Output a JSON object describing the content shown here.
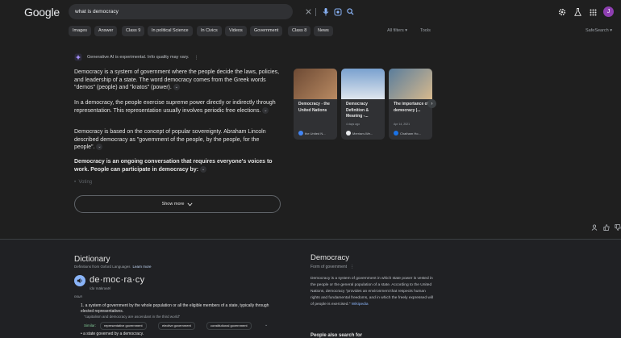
{
  "header": {
    "logo": "Google",
    "search": {
      "value": "what is democracy"
    },
    "avatar_initial": "J"
  },
  "chips": [
    "Images",
    "Answer",
    "Class 9",
    "In political Science",
    "In Civics",
    "Videos",
    "Government",
    "Class 8",
    "News"
  ],
  "tools": {
    "all_filters": "All filters",
    "tools": "Tools",
    "safesearch": "SafeSearch"
  },
  "ai_overview": {
    "label": "Generative AI is experimental. Info quality may vary.",
    "p1": "Democracy is a system of government where the people decide the laws, policies, and leadership of a state. The word democracy comes from the Greek words \"demos\" (people) and \"kratos\" (power).",
    "p2": "In a democracy, the people exercise supreme power directly or indirectly through representation. This representation usually involves periodic free elections.",
    "p3": "Democracy is based on the concept of popular sovereignty. Abraham Lincoln described democracy as \"government of the people, by the people, for the people\".",
    "p4": "Democracy is an ongoing conversation that requires everyone's voices to work. People can participate in democracy by:",
    "faded_item": "Voting",
    "show_more": "Show more"
  },
  "cards": [
    {
      "title": "Democracy - the United Nations",
      "date": "",
      "source": "the United N...",
      "fav_color": "#4285f4",
      "img_colors": [
        "#6d4a34",
        "#b98a62"
      ]
    },
    {
      "title": "Democracy Definition & Meaning -...",
      "date": "4 days ago",
      "source": "Merriam-We...",
      "fav_color": "#e8eaed",
      "img_colors": [
        "#7aa1cf",
        "#dfe6ee"
      ]
    },
    {
      "title": "The importance of democracy |...",
      "date": "Apr 14, 2021",
      "source": "Chatham Ho...",
      "fav_color": "#1a73e8",
      "img_colors": [
        "#5a7d9c",
        "#d7b98d"
      ]
    }
  ],
  "dictionary": {
    "heading": "Dictionary",
    "source": "Definitions from Oxford Languages",
    "learn_more": "Learn more",
    "word": "de·moc·ra·cy",
    "phonetic": "/dəˈmäkrəsē/",
    "pos": "noun",
    "def1": "a system of government by the whole population or all the eligible members of a state, typically through elected representatives.",
    "example1": "\"capitalism and democracy are ascendant in the third world\"",
    "similar_label": "Similar:",
    "similar": [
      "representative government",
      "elective government",
      "constitutional government"
    ],
    "def2": "a state governed by a democracy."
  },
  "knowledge_panel": {
    "title": "Democracy",
    "subtitle": "Form of government",
    "body": "Democracy is a system of government in which state power is vested in the people or the general population of a state. According to the United Nations, democracy \"provides an environment that respects human rights and fundamental freedoms, and in which the freely expressed will of people is exercised.\"",
    "wiki": "Wikipedia",
    "people_also_search": "People also search for"
  }
}
